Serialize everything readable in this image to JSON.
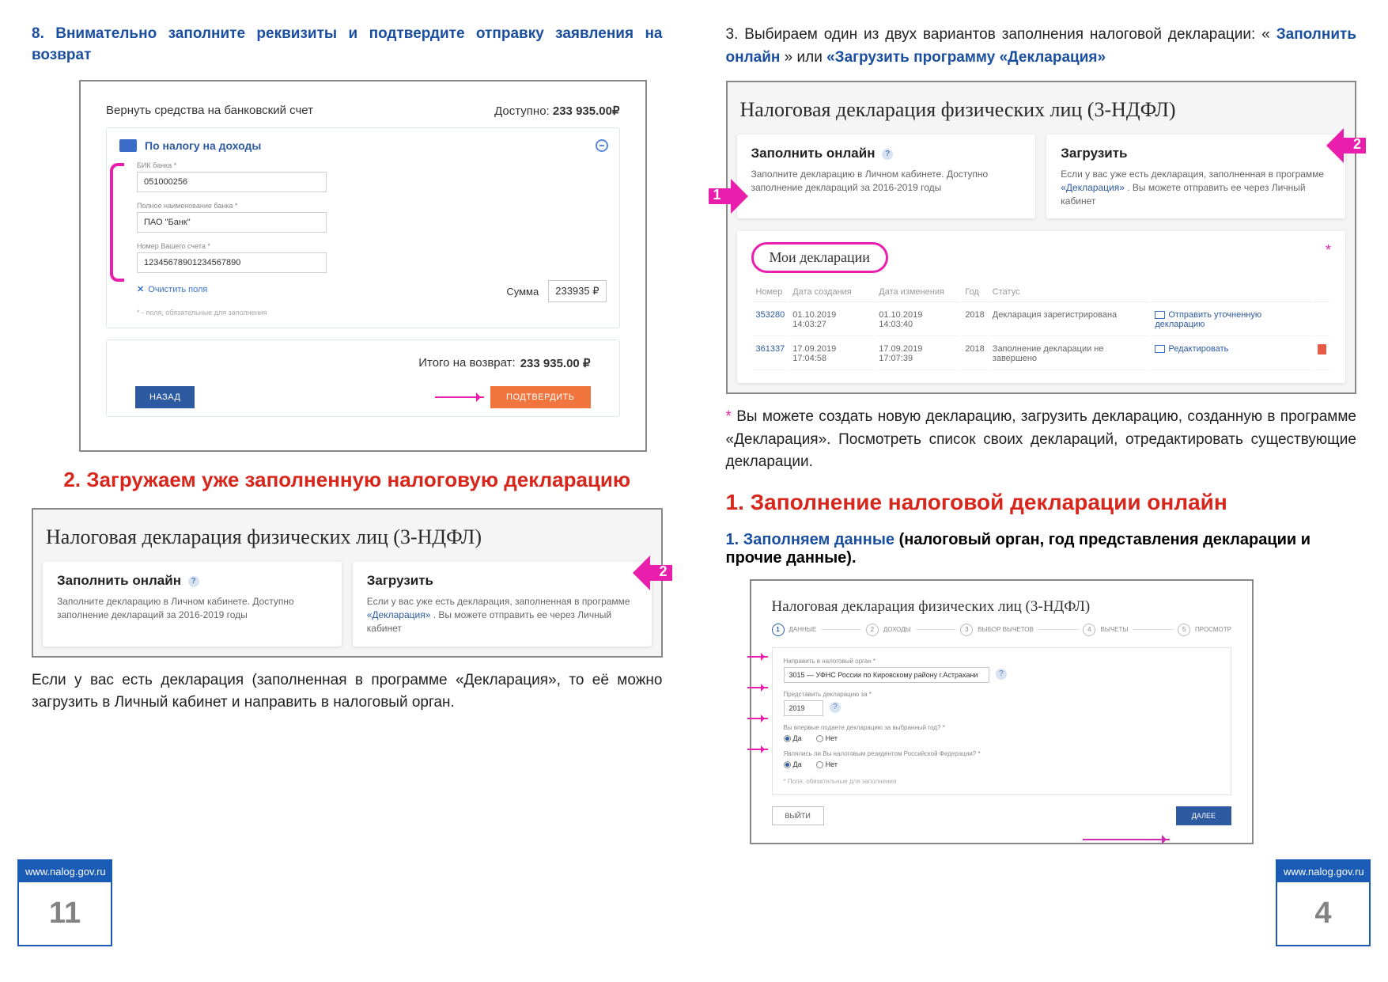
{
  "left": {
    "heading8": "8. Внимательно заполните реквизиты и подтвердите отправку заявления на возврат",
    "bank": {
      "title": "Вернуть средства на банковский счет",
      "avail_label": "Доступно:",
      "avail_value": "233 935.00₽",
      "section": "По налогу на доходы",
      "fields": {
        "bik_label": "БИК банка *",
        "bik_value": "051000256",
        "name_label": "Полное наименование банка *",
        "name_value": "ПАО \"Банк\"",
        "acct_label": "Номер Вашего счета *",
        "acct_value": "12345678901234567890"
      },
      "clear": "Очистить поля",
      "required_hint": "* - поля, обязательные для заполнения",
      "sum_label": "Сумма",
      "sum_value": "233935 ₽",
      "total_label": "Итого на возврат:",
      "total_value": "233 935.00 ₽",
      "btn_back": "НАЗАД",
      "btn_confirm": "ПОДТВЕРДИТЬ"
    },
    "heading_red": "2. Загружаем уже заполненную налоговую декларацию",
    "decl_card": {
      "title": "Налоговая декларация физических лиц (3-НДФЛ)",
      "online_h": "Заполнить онлайн",
      "online_t": "Заполните декларацию в Личном кабинете. Доступно заполнение деклараций за 2016-2019 годы",
      "upload_h": "Загрузить",
      "upload_t_a": "Если у вас уже есть декларация, заполненная в программе ",
      "upload_t_link": "«Декларация»",
      "upload_t_b": ". Вы можете отправить ее через Личный кабинет"
    },
    "body1": "Если у вас есть декларация (заполненная в программе «Декларация», то её можно загрузить в Личный кабинет и направить в налоговый орган.",
    "url": "www.nalog.gov.ru",
    "page": "11",
    "arrow2": "2"
  },
  "right": {
    "para3_a": "3. Выбираем один из двух вариантов заполнения налоговой декларации: «",
    "para3_b": "Заполнить онлайн",
    "para3_c": "» или ",
    "para3_d": "«Загрузить программу «Декларация»",
    "decl_card": {
      "title": "Налоговая декларация физических лиц (3-НДФЛ)",
      "online_h": "Заполнить онлайн",
      "online_t": "Заполните декларацию в Личном кабинете. Доступно заполнение деклараций за 2016-2019 годы",
      "upload_h": "Загрузить",
      "upload_t_a": "Если у вас уже есть декларация, заполненная в программе ",
      "upload_t_link": "«Декларация»",
      "upload_t_b": ". Вы можете отправить ее через Личный кабинет",
      "my_decl": "Мои декларации",
      "cols": {
        "num": "Номер",
        "created": "Дата создания",
        "changed": "Дата изменения",
        "year": "Год",
        "status": "Статус"
      },
      "rows": [
        {
          "num": "353280",
          "created": "01.10.2019 14:03:27",
          "changed": "01.10.2019 14:03:40",
          "year": "2018",
          "status": "Декларация зарегистрирована",
          "action": "Отправить уточненную декларацию"
        },
        {
          "num": "361337",
          "created": "17.09.2019 17:04:58",
          "changed": "17.09.2019 17:07:39",
          "year": "2018",
          "status": "Заполнение декларации не завершено",
          "action": "Редактировать"
        }
      ]
    },
    "arrow1": "1",
    "arrow2": "2",
    "note_star": "*",
    "note_body": "Вы можете создать новую декларацию, загрузить декларацию, созданную в программе «Декларация». Посмотреть список своих деклараций, отредактировать существующие декларации.",
    "heading_red": "1. Заполнение налоговой декларации онлайн",
    "heading_blue_a": "1. Заполняем данные",
    "heading_black_b": " (налоговый орган, год представления декларации и прочие данные).",
    "wizard": {
      "title": "Налоговая декларация физических лиц (3-НДФЛ)",
      "steps": [
        "ДАННЫЕ",
        "ДОХОДЫ",
        "ВЫБОР ВЫЧЕТОВ",
        "ВЫЧЕТЫ",
        "ПРОСМОТР"
      ],
      "f1_label": "Направить в налоговый орган *",
      "f1_value": "3015 — УФНС России по Кировскому району г.Астрахани",
      "f2_label": "Представить декларацию за *",
      "f2_value": "2019",
      "q1": "Вы впервые подаете декларацию за выбранный год? *",
      "q2": "Являлись ли Вы налоговым резидентом Российской Федерации? *",
      "yes": "Да",
      "no": "Нет",
      "hint": "* Поля, обязательные для заполнения",
      "btn_exit": "ВЫЙТИ",
      "btn_next": "ДАЛЕЕ"
    },
    "url": "www.nalog.gov.ru",
    "page": "4"
  }
}
